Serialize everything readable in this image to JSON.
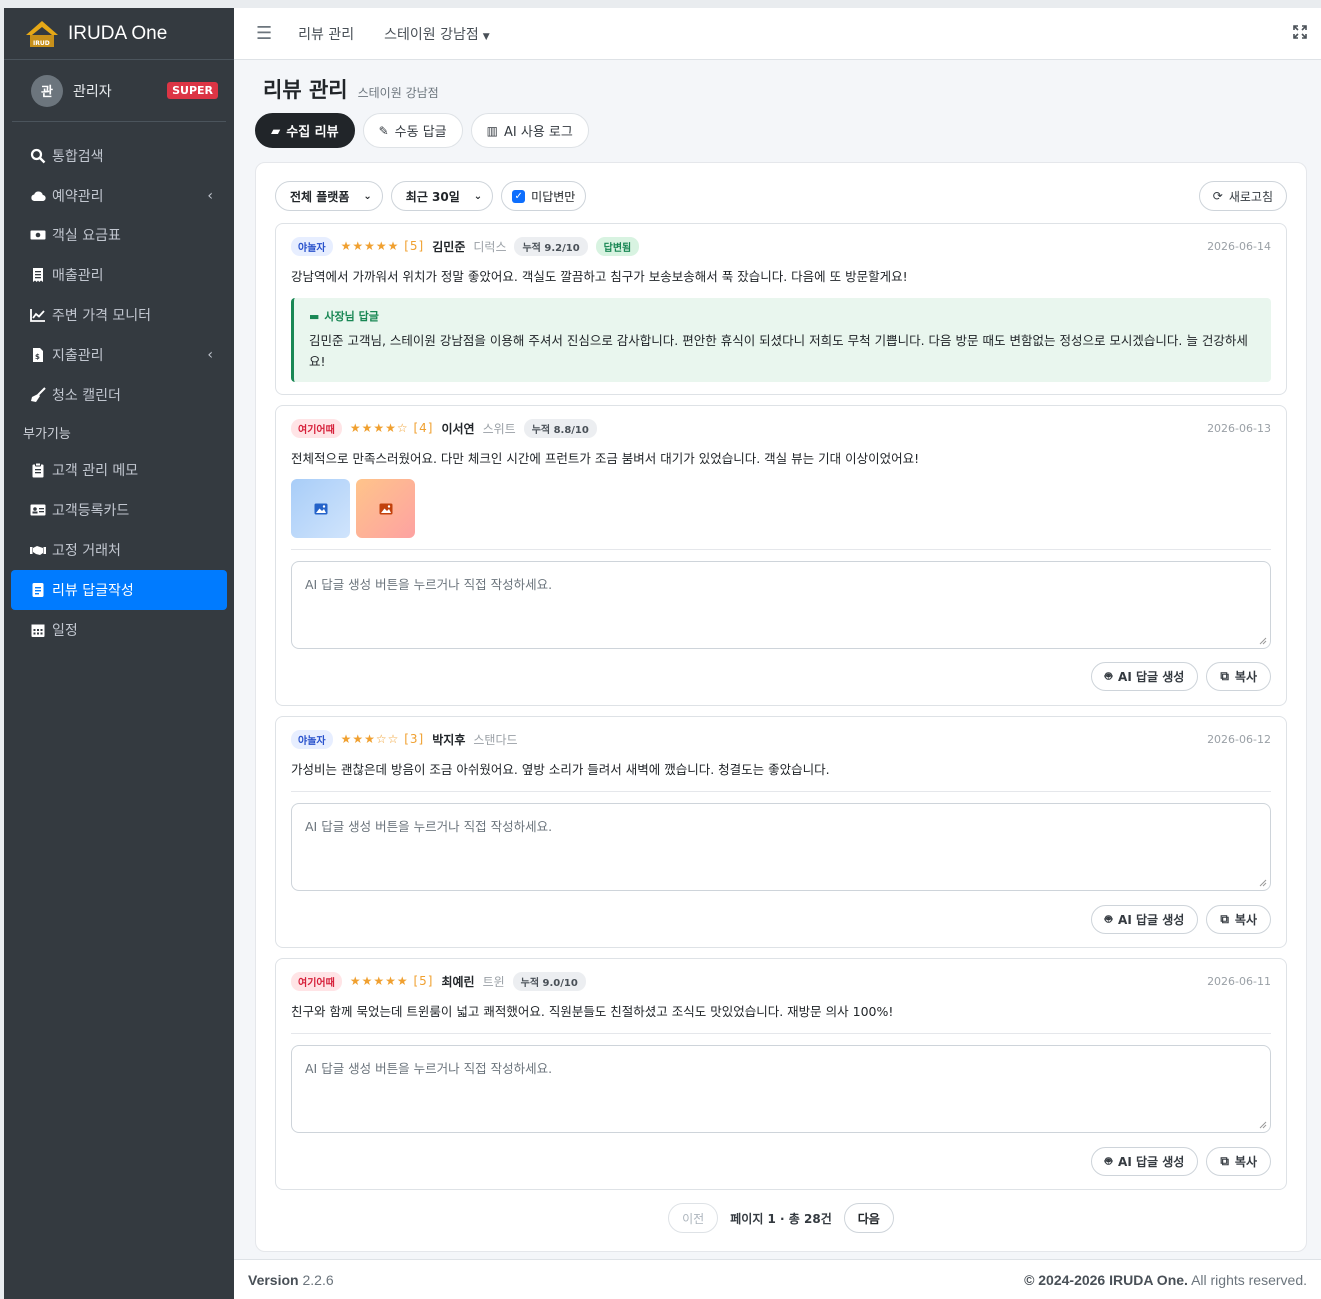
{
  "brand": {
    "name": "IRUDA One"
  },
  "user": {
    "initial": "관",
    "name": "관리자",
    "badge": "SUPER"
  },
  "sidebar": {
    "items": [
      {
        "label": "통합검색"
      },
      {
        "label": "예약관리"
      },
      {
        "label": "객실 요금표"
      },
      {
        "label": "매출관리"
      },
      {
        "label": "주변 가격 모니터"
      },
      {
        "label": "지출관리"
      },
      {
        "label": "청소 캘린더"
      }
    ],
    "section_header": "부가기능",
    "extra_items": [
      {
        "label": "고객 관리 메모"
      },
      {
        "label": "고객등록카드"
      },
      {
        "label": "고정 거래처"
      },
      {
        "label": "리뷰 답글작성"
      },
      {
        "label": "일정"
      }
    ]
  },
  "topbar": {
    "link1": "리뷰 관리",
    "link2": "스테이원 강남점"
  },
  "page": {
    "title": "리뷰 관리",
    "subtitle": "스테이원 강남점"
  },
  "tabs": [
    {
      "label": "수집 리뷰"
    },
    {
      "label": "수동 답글"
    },
    {
      "label": "AI 사용 로그"
    }
  ],
  "filters": {
    "platform": "전체 플랫폼",
    "period": "최근 30일",
    "unanswered": "미답변만",
    "refresh": "새로고침"
  },
  "reviews": [
    {
      "platform": "야놀자",
      "stars": "★★★★★",
      "rating": "[5]",
      "name": "김민준",
      "room": "디럭스",
      "score": "누적 9.2/10",
      "status": "답변됨",
      "date": "2026-06-14",
      "text": "강남역에서 가까워서 위치가 정말 좋았어요. 객실도 깔끔하고 침구가 보송보송해서 푹 잤습니다. 다음에 또 방문할게요!",
      "reply_title": "사장님 답글",
      "reply": "김민준 고객님, 스테이원 강남점을 이용해 주셔서 진심으로 감사합니다. 편안한 휴식이 되셨다니 저희도 무척 기쁩니다. 다음 방문 때도 변함없는 정성으로 모시겠습니다. 늘 건강하세요!"
    },
    {
      "platform": "여기어때",
      "stars": "★★★★☆",
      "rating": "[4]",
      "name": "이서연",
      "room": "스위트",
      "score": "누적 8.8/10",
      "date": "2026-06-13",
      "text": "전체적으로 만족스러웠어요. 다만 체크인 시간에 프런트가 조금 붐벼서 대기가 있었습니다. 객실 뷰는 기대 이상이었어요!",
      "placeholder": "AI 답글 생성 버튼을 누르거나 직접 작성하세요."
    },
    {
      "platform": "야놀자",
      "stars": "★★★☆☆",
      "rating": "[3]",
      "name": "박지후",
      "room": "스탠다드",
      "date": "2026-06-12",
      "text": "가성비는 괜찮은데 방음이 조금 아쉬웠어요. 옆방 소리가 들려서 새벽에 깼습니다. 청결도는 좋았습니다.",
      "placeholder": "AI 답글 생성 버튼을 누르거나 직접 작성하세요."
    },
    {
      "platform": "여기어때",
      "stars": "★★★★★",
      "rating": "[5]",
      "name": "최예린",
      "room": "트윈",
      "score": "누적 9.0/10",
      "date": "2026-06-11",
      "text": "친구와 함께 묵었는데 트윈룸이 넓고 쾌적했어요. 직원분들도 친절하셨고 조식도 맛있었습니다. 재방문 의사 100%!",
      "placeholder": "AI 답글 생성 버튼을 누르거나 직접 작성하세요."
    }
  ],
  "actions": {
    "ai_generate": "AI 답글 생성",
    "copy": "복사"
  },
  "pager": {
    "prev": "이전",
    "info": "페이지 1 · 총 28건",
    "next": "다음"
  },
  "footer": {
    "version_label": "Version",
    "version": "2.2.6",
    "copyright": "© 2024-2026",
    "brand": "IRUDA One.",
    "rights": "All rights reserved."
  },
  "colors": {
    "sidebar": "#343a40",
    "active": "#007bff",
    "reply_bg": "#e9f6ee",
    "reply_border": "#198754"
  }
}
